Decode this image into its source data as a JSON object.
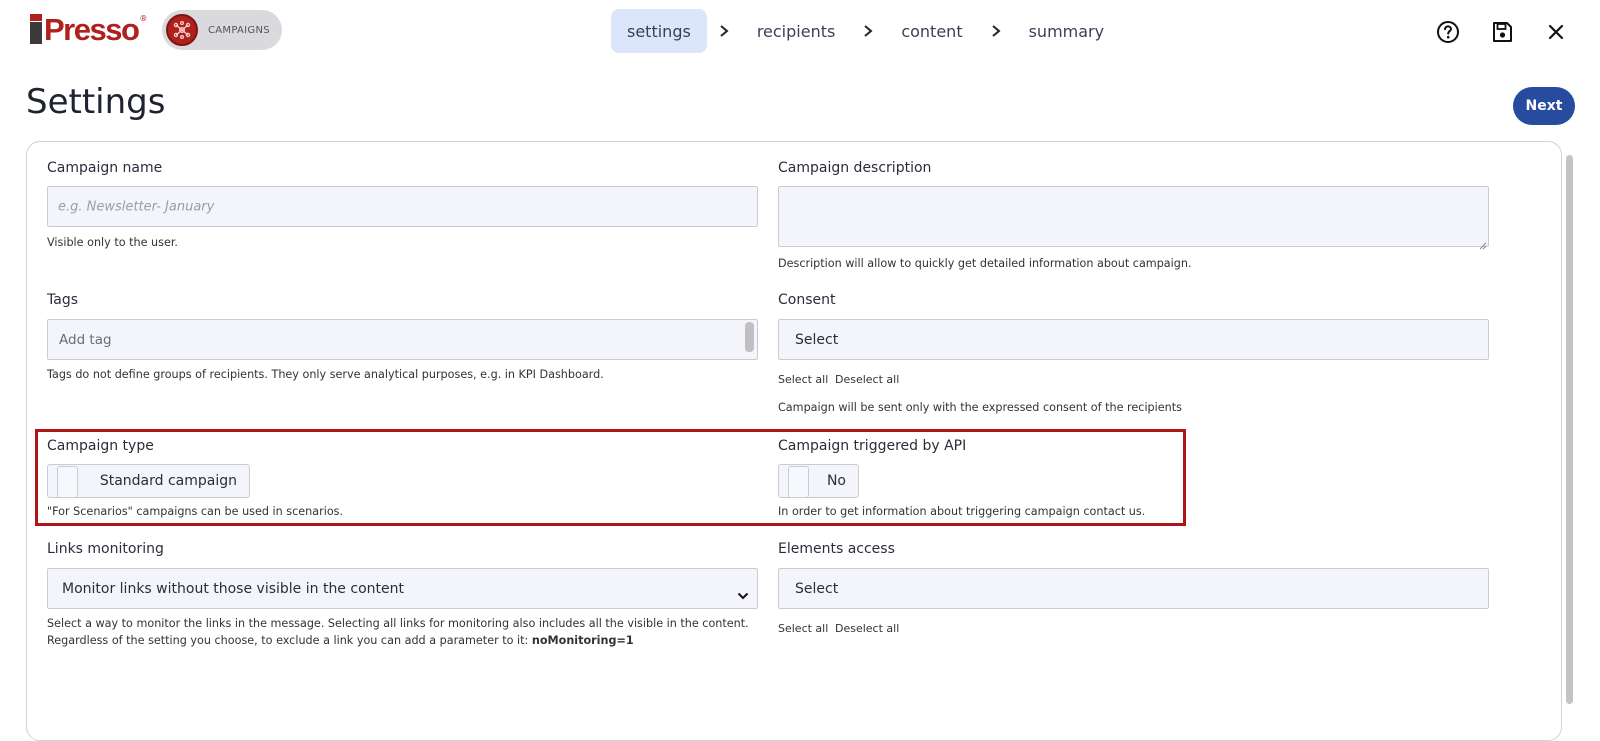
{
  "header": {
    "logo_text": "Presso",
    "logo_mark": "®",
    "module_label": "CAMPAIGNS",
    "module_icon": "campaign-network-icon",
    "steps": [
      {
        "label": "settings",
        "active": true
      },
      {
        "label": "recipients",
        "active": false
      },
      {
        "label": "content",
        "active": false
      },
      {
        "label": "summary",
        "active": false
      }
    ],
    "actions": [
      "help-icon",
      "save-icon",
      "close-icon"
    ]
  },
  "page": {
    "title": "Settings",
    "next_label": "Next"
  },
  "form": {
    "campaign_name": {
      "label": "Campaign name",
      "placeholder": "e.g. Newsletter- January",
      "hint": "Visible only to the user."
    },
    "campaign_description": {
      "label": "Campaign description",
      "value": "",
      "hint": "Description will allow to quickly get detailed information about campaign."
    },
    "tags": {
      "label": "Tags",
      "placeholder": "Add tag",
      "hint": "Tags do not define groups of recipients. They only serve analytical purposes, e.g. in KPI Dashboard."
    },
    "consent": {
      "label": "Consent",
      "value": "Select",
      "select_all": "Select all",
      "deselect_all": "Deselect all",
      "hint": "Campaign will be sent only with the expressed consent of the recipients"
    },
    "campaign_type": {
      "label": "Campaign type",
      "value": "Standard campaign",
      "hint": "\"For Scenarios\" campaigns can be used in scenarios."
    },
    "triggered_by_api": {
      "label": "Campaign triggered by API",
      "value": "No",
      "hint": "In order to get information about triggering campaign contact us."
    },
    "links_monitoring": {
      "label": "Links monitoring",
      "value": "Monitor links without those visible in the content",
      "hint_line1": "Select a way to monitor the links in the message. Selecting all links for monitoring also includes all the visible in the content.",
      "hint_line2": "Regardless of the setting you choose, to exclude a link you can add a parameter to it:",
      "hint_code": "noMonitoring=1"
    },
    "elements_access": {
      "label": "Elements access",
      "value": "Select",
      "select_all": "Select all",
      "deselect_all": "Deselect all"
    }
  },
  "colors": {
    "brand_red": "#b0201c",
    "primary_blue": "#274b9f",
    "active_step_bg": "#dce6fb",
    "highlight_border": "#b01417"
  }
}
